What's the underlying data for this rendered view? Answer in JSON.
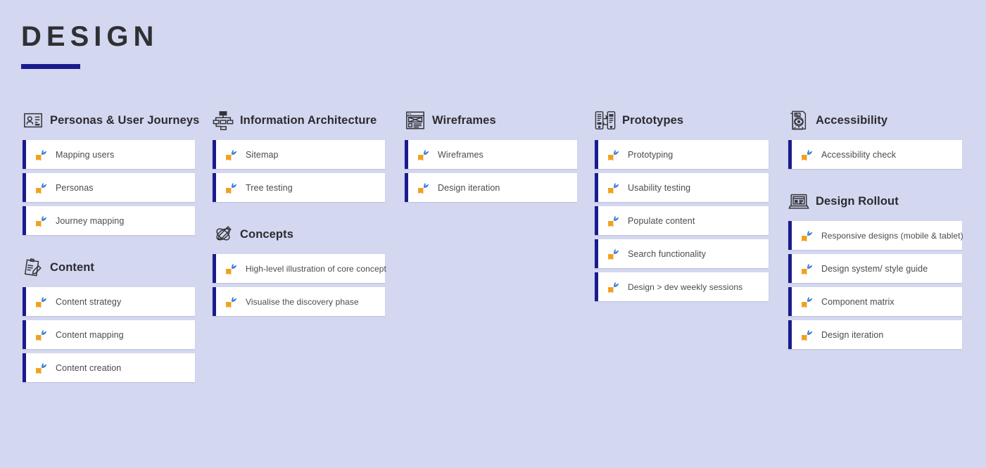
{
  "header": {
    "title": "DESIGN",
    "accent_color": "#1b1b8f"
  },
  "theme": {
    "background": "#d3d7ef",
    "card_background": "#ffffff",
    "card_stripe": "#1b1b8f",
    "title_color": "#2f3034",
    "header_text_color": "#2b2b30",
    "card_text_color": "#4a4a52",
    "task_icon_orange": "#f5a623",
    "task_icon_blue": "#2f6fd0"
  },
  "columns": [
    {
      "groups": [
        {
          "title": "Personas & User Journeys",
          "icon": "id-card-icon",
          "items": [
            {
              "label": "Mapping users"
            },
            {
              "label": "Personas"
            },
            {
              "label": "Journey mapping"
            }
          ]
        },
        {
          "title": "Content",
          "icon": "clipboard-pencil-icon",
          "items": [
            {
              "label": "Content strategy"
            },
            {
              "label": "Content mapping"
            },
            {
              "label": "Content creation"
            }
          ]
        }
      ]
    },
    {
      "groups": [
        {
          "title": "Information Architecture",
          "icon": "sitemap-icon",
          "items": [
            {
              "label": "Sitemap"
            },
            {
              "label": "Tree testing"
            }
          ]
        },
        {
          "title": "Concepts",
          "icon": "sketch-pen-icon",
          "items": [
            {
              "label": "High-level illustration of core concept"
            },
            {
              "label": "Visualise the discovery phase"
            }
          ]
        }
      ]
    },
    {
      "groups": [
        {
          "title": "Wireframes",
          "icon": "wireframe-layout-icon",
          "items": [
            {
              "label": "Wireframes"
            },
            {
              "label": "Design iteration"
            }
          ]
        }
      ]
    },
    {
      "groups": [
        {
          "title": "Prototypes",
          "icon": "phone-flow-icon",
          "items": [
            {
              "label": "Prototyping"
            },
            {
              "label": "Usability testing"
            },
            {
              "label": "Populate content"
            },
            {
              "label": "Search functionality"
            },
            {
              "label": "Design > dev weekly sessions"
            }
          ]
        }
      ]
    },
    {
      "groups": [
        {
          "title": "Accessibility",
          "icon": "document-eye-icon",
          "items": [
            {
              "label": "Accessibility check"
            }
          ]
        },
        {
          "title": "Design Rollout",
          "icon": "laptop-icon",
          "items": [
            {
              "label": "Responsive designs (mobile & tablet)"
            },
            {
              "label": "Design system/ style guide"
            },
            {
              "label": "Component matrix"
            },
            {
              "label": "Design iteration"
            }
          ]
        }
      ]
    }
  ]
}
